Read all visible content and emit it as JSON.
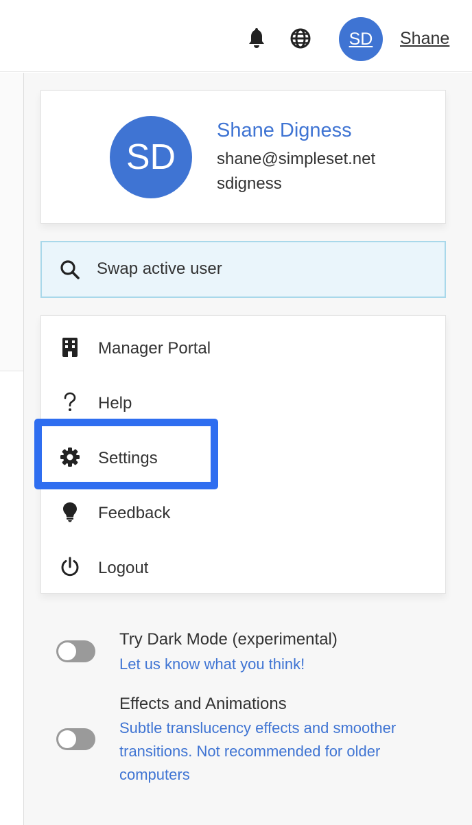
{
  "header": {
    "avatar_initials": "SD",
    "user_name": "Shane",
    "icons": [
      "bell-icon",
      "globe-icon"
    ]
  },
  "profile": {
    "initials": "SD",
    "name": "Shane Digness",
    "email": "shane@simpleset.net",
    "username": "sdigness"
  },
  "swap": {
    "label": "Swap active user",
    "icon": "search-icon"
  },
  "menu": {
    "items": [
      {
        "label": "Manager Portal",
        "icon": "building-icon"
      },
      {
        "label": "Help",
        "icon": "question-icon"
      },
      {
        "label": "Settings",
        "icon": "gear-icon"
      },
      {
        "label": "Feedback",
        "icon": "lightbulb-icon"
      },
      {
        "label": "Logout",
        "icon": "power-icon"
      }
    ],
    "highlighted": "Settings"
  },
  "settings": {
    "dark_mode": {
      "title": "Try Dark Mode (experimental)",
      "description": "Let us know what you think!",
      "enabled": false
    },
    "effects": {
      "title": "Effects and Animations",
      "description": "Subtle translucency effects and smoother transitions. Not recommended for older computers",
      "enabled": false
    }
  },
  "colors": {
    "accent": "#3f74d3",
    "highlight": "#2f6ef0",
    "swap_bg": "#eaf5fb",
    "toggle_off": "#9a9a9a"
  }
}
